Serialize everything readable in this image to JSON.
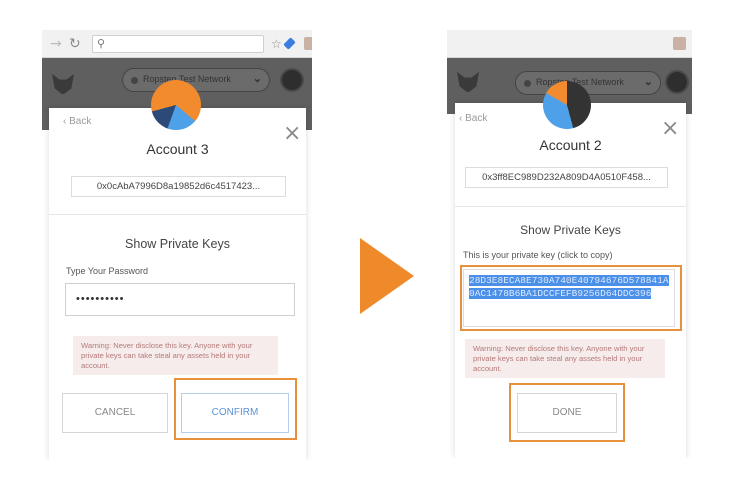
{
  "colors": {
    "accent_orange": "#E8913C",
    "selection_blue": "#4A8FE8",
    "header_gray": "#5F5F5F",
    "warning_bg": "#F5ECEB"
  },
  "icons": {
    "back": "left-arrow",
    "reload": "reload-icon",
    "search": "search-icon",
    "bookmark": "star-icon",
    "close": "close-icon",
    "arrow": "right-pointing-triangle"
  },
  "left": {
    "network": "Ropsten Test Network",
    "back": "Back",
    "account_name": "Account 3",
    "address": "0x0cAbA7996D8a19852d6c4517423...",
    "section_title": "Show Private Keys",
    "password_label": "Type Your Password",
    "password_value": "••••••••••",
    "warning": "Warning: Never disclose this key. Anyone with your private keys can take steal any assets held in your account.",
    "cancel": "CANCEL",
    "confirm": "CONFIRM"
  },
  "right": {
    "network": "Ropsten Test Network",
    "back": "Back",
    "account_name": "Account 2",
    "address": "0x3ff8EC989D232A809D4A0510F458...",
    "section_title": "Show Private Keys",
    "key_label": "This is your private key (click to copy)",
    "private_key": "28D3E8ECA8E730A740E40794676D578841A0AC1478B6BA1DCCFEFB9256D64DDC396",
    "warning": "Warning: Never disclose this key. Anyone with your private keys can take steal any assets held in your account.",
    "done": "DONE"
  }
}
